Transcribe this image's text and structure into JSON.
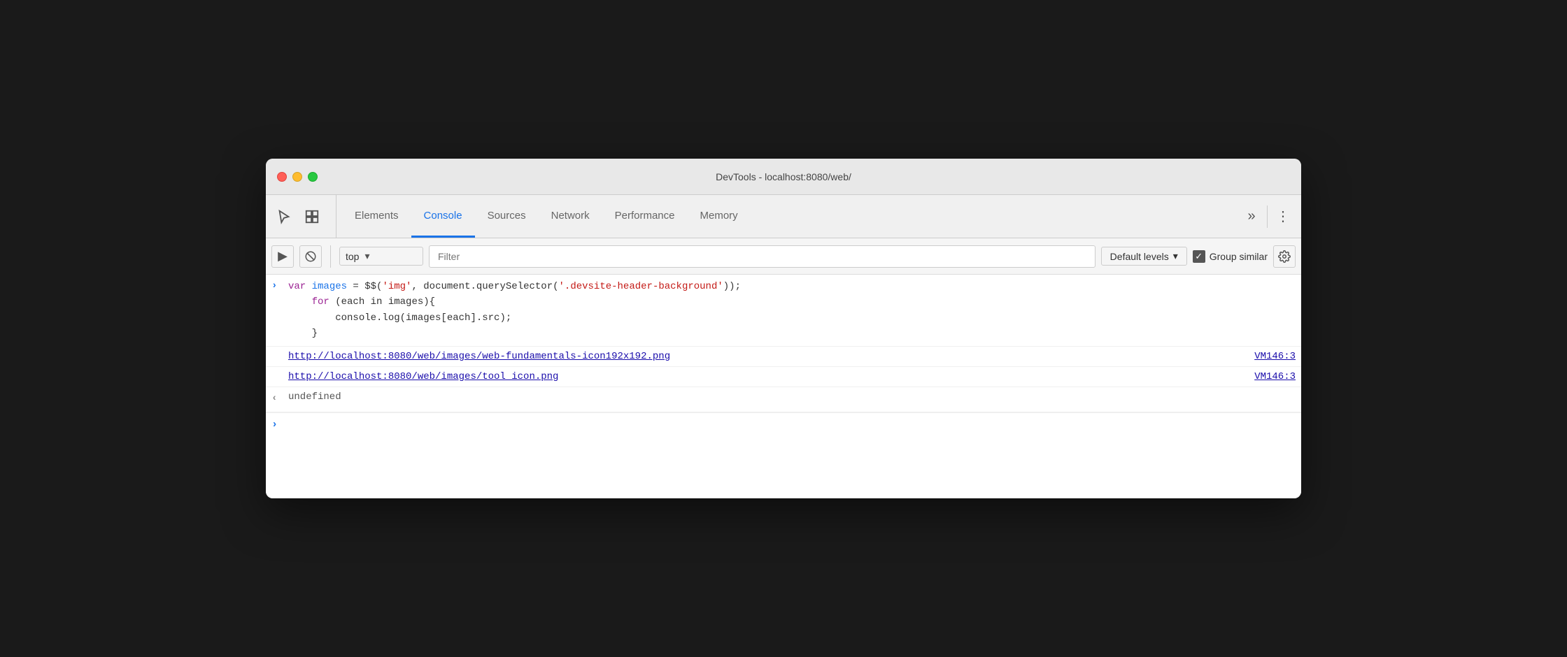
{
  "window": {
    "title": "DevTools - localhost:8080/web/"
  },
  "traffic_lights": {
    "close_label": "close",
    "minimize_label": "minimize",
    "maximize_label": "maximize"
  },
  "tabs": {
    "items": [
      {
        "id": "elements",
        "label": "Elements",
        "active": false
      },
      {
        "id": "console",
        "label": "Console",
        "active": true
      },
      {
        "id": "sources",
        "label": "Sources",
        "active": false
      },
      {
        "id": "network",
        "label": "Network",
        "active": false
      },
      {
        "id": "performance",
        "label": "Performance",
        "active": false
      },
      {
        "id": "memory",
        "label": "Memory",
        "active": false
      }
    ],
    "more_label": "»",
    "menu_label": "⋮"
  },
  "toolbar": {
    "console_sidebar_label": "▶",
    "clear_label": "🚫",
    "context_value": "top",
    "context_arrow": "▾",
    "filter_placeholder": "Filter",
    "levels_label": "Default levels",
    "levels_arrow": "▾",
    "group_similar_label": "Group similar",
    "settings_label": "⚙"
  },
  "console": {
    "entries": [
      {
        "type": "input",
        "arrow": ">",
        "code_parts": [
          {
            "type": "kw-var",
            "text": "var "
          },
          {
            "type": "var-name",
            "text": "images"
          },
          {
            "type": "plain",
            "text": " = $$('img', document.querySelector('"
          },
          {
            "type": "str-val",
            "text": ".devsite-header-background"
          },
          {
            "type": "plain",
            "text": "'));"
          }
        ],
        "extra_lines": [
          "    for (each in images){",
          "        console.log(images[each].src);",
          "    }"
        ]
      }
    ],
    "url_results": [
      {
        "url": "http://localhost:8080/web/images/web-fundamentals-icon192x192.png",
        "ref": "VM146:3"
      },
      {
        "url": "http://localhost:8080/web/images/tool_icon.png",
        "ref": "VM146:3"
      }
    ],
    "undefined_arrow": "«",
    "undefined_text": "undefined"
  }
}
